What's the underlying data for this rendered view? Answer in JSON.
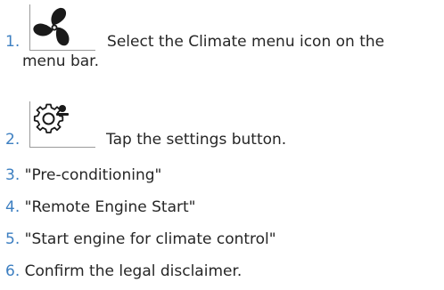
{
  "steps": [
    {
      "num": "1.",
      "text": "Select the Climate menu icon on the",
      "cont": "menu bar.",
      "icon": "fan-icon"
    },
    {
      "num": "2.",
      "text": "Tap the settings button.",
      "icon": "settings-person-icon"
    },
    {
      "num": "3.",
      "text": "\"Pre-conditioning\""
    },
    {
      "num": "4.",
      "text": "\"Remote Engine Start\""
    },
    {
      "num": "5.",
      "text": "\"Start engine for climate control\""
    },
    {
      "num": "6.",
      "text": "Confirm the legal disclaimer."
    }
  ],
  "colors": {
    "number": "#3d7fc1",
    "text": "#262626",
    "icon": "#1a1a1a",
    "frame": "#9a9a9a"
  }
}
